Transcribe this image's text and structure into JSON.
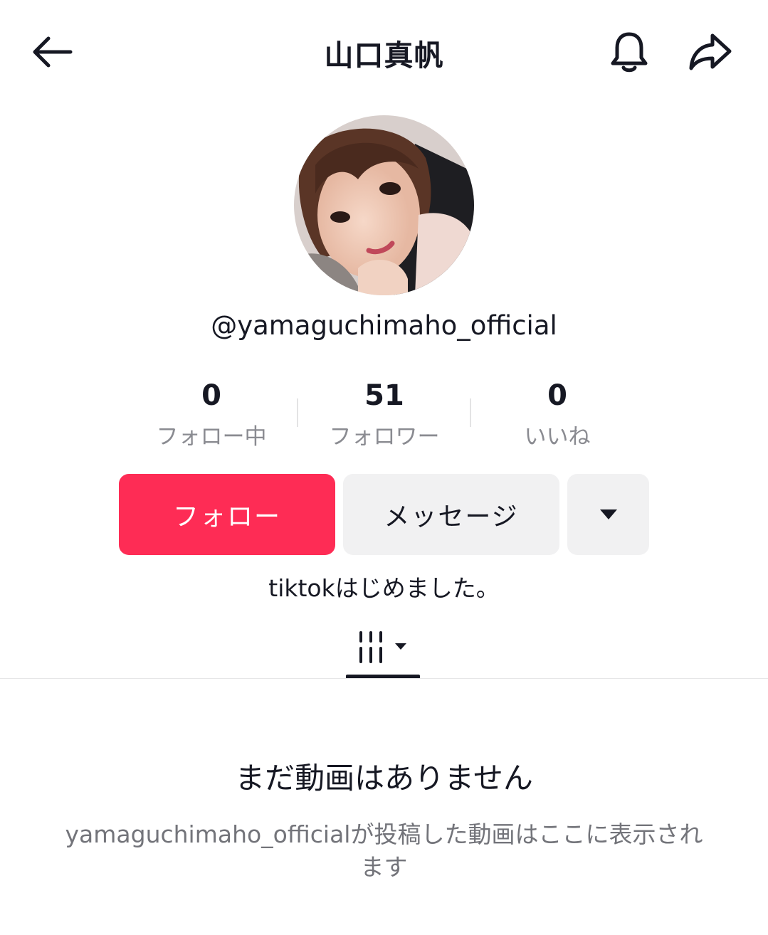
{
  "header": {
    "title": "山口真帆",
    "back_icon": "arrow-left-icon",
    "bell_icon": "bell-icon",
    "share_icon": "share-arrow-icon"
  },
  "profile": {
    "username": "@yamaguchimaho_official",
    "bio": "tiktokはじめました。"
  },
  "stats": [
    {
      "value": "0",
      "label": "フォロー中"
    },
    {
      "value": "51",
      "label": "フォロワー"
    },
    {
      "value": "0",
      "label": "いいね"
    }
  ],
  "actions": {
    "follow_label": "フォロー",
    "message_label": "メッセージ",
    "dropdown_icon": "caret-down-icon"
  },
  "tabs": {
    "videos_icon": "videos-grid-icon"
  },
  "empty_state": {
    "title": "まだ動画はありません",
    "description": "yamaguchimaho_officialが投稿した動画はここに表示されます"
  },
  "colors": {
    "accent": "#fe2c55",
    "button_gray": "#f1f1f2",
    "text_primary": "#161823",
    "text_secondary": "#8a8b91"
  }
}
